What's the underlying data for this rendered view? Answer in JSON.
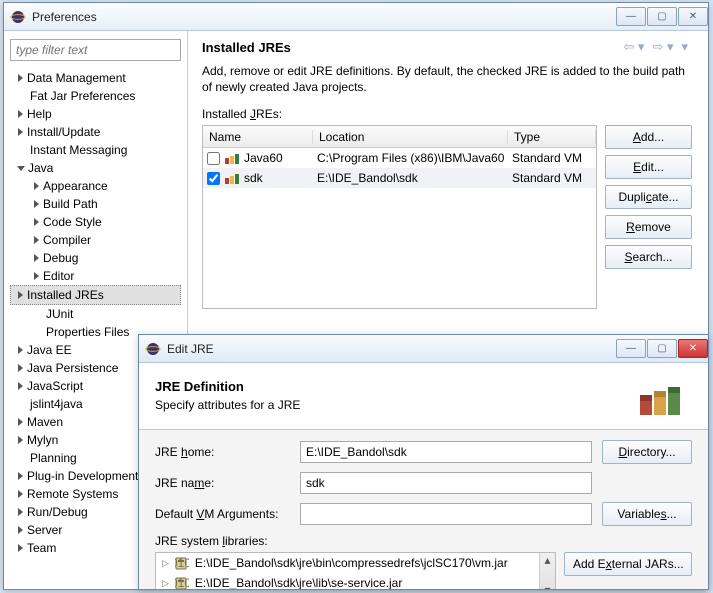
{
  "prefs": {
    "window_title": "Preferences",
    "filter_placeholder": "type filter text",
    "tree": {
      "data_mgmt": "Data Management",
      "fatjar": "Fat Jar Preferences",
      "help": "Help",
      "install": "Install/Update",
      "im": "Instant Messaging",
      "java": "Java",
      "appearance": "Appearance",
      "buildpath": "Build Path",
      "codestyle": "Code Style",
      "compiler": "Compiler",
      "debug": "Debug",
      "editor": "Editor",
      "installedjres": "Installed JREs",
      "junit": "JUnit",
      "propfiles": "Properties Files",
      "javaee": "Java EE",
      "javapersist": "Java Persistence",
      "javascript": "JavaScript",
      "jslint": "jslint4java",
      "maven": "Maven",
      "mylyn": "Mylyn",
      "planning": "Planning",
      "plugindev": "Plug-in Development",
      "remotesys": "Remote Systems",
      "rundebug": "Run/Debug",
      "server": "Server",
      "team": "Team"
    },
    "pane": {
      "title": "Installed JREs",
      "desc": "Add, remove or edit JRE definitions. By default, the checked JRE is added to the build path of newly created Java projects.",
      "subtitle_pre": "Installed ",
      "subtitle_u": "J",
      "subtitle_post": "REs:",
      "cols": {
        "name": "Name",
        "location": "Location",
        "type": "Type"
      },
      "rows": [
        {
          "checked": false,
          "name": "Java60",
          "location": "C:\\Program Files (x86)\\IBM\\Java60",
          "type": "Standard VM"
        },
        {
          "checked": true,
          "name": "sdk",
          "location": "E:\\IDE_Bandol\\sdk",
          "type": "Standard VM"
        }
      ],
      "buttons": {
        "add": "Add...",
        "edit": "Edit...",
        "duplicate": "Duplicate...",
        "remove": "Remove",
        "search": "Search..."
      }
    }
  },
  "edit": {
    "window_title": "Edit JRE",
    "banner_title": "JRE Definition",
    "banner_sub": "Specify attributes for a JRE",
    "labels": {
      "jrehome_pre": "JRE ",
      "jrehome_u": "h",
      "jrehome_post": "ome:",
      "jrename_pre": "JRE na",
      "jrename_u": "m",
      "jrename_post": "e:",
      "defvm_pre": "Default ",
      "defvm_u": "V",
      "defvm_post": "M Arguments:",
      "syslib_pre": "JRE system ",
      "syslib_u": "l",
      "syslib_post": "ibraries:"
    },
    "values": {
      "jrehome": "E:\\IDE_Bandol\\sdk",
      "jrename": "sdk",
      "defvm": ""
    },
    "buttons": {
      "directory": "Directory...",
      "variables": "Variables...",
      "addext": "Add External JARs..."
    },
    "libs": [
      "E:\\IDE_Bandol\\sdk\\jre\\bin\\compressedrefs\\jclSC170\\vm.jar",
      "E:\\IDE_Bandol\\sdk\\jre\\lib\\se-service.jar"
    ]
  }
}
